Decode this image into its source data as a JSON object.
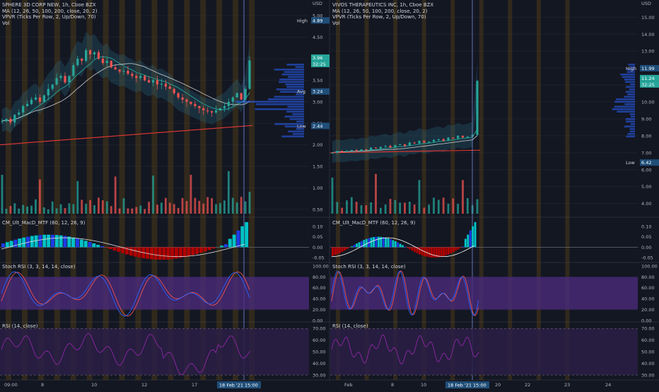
{
  "colors": {
    "bg": "#131722",
    "grid": "#1e222d",
    "up": "#26a69a",
    "down": "#ef5350",
    "macd_hist_up": "#00c2c7",
    "macd_hist_up2": "#1e3ae8",
    "macd_hist_down": "#b20000",
    "stoch_band": "#4a2a7a",
    "rsi_band": "#2a1f45",
    "stoch_k": "#2962ff",
    "stoch_d": "#ef5350",
    "rsi_line": "#9c27b0",
    "ma_red": "#e53935",
    "ma_white": "#e0e0e0",
    "ma_teal": "#26a69a",
    "session_highlight": "#6b4a12",
    "cursor_line": "#7b8bd6",
    "label_blue": "#1f4e79"
  },
  "panes": [
    {
      "id": "left",
      "title": "SPHERE 3D CORP NEW, 1h, Cboe BZX",
      "indicators": [
        "MA (12, 26, 50, 100, 200, close, 20, 2)",
        "VPVR (Ticks Per Row, 2, Up/Down, 70)",
        "Vol"
      ],
      "currency": "USD",
      "price_axis": [
        "5.00",
        "4.50",
        "4.00",
        "3.50",
        "3.00",
        "2.50",
        "2.00",
        "1.50",
        "1.00",
        "0.50"
      ],
      "price_range": [
        0.4,
        5.2
      ],
      "labels": {
        "high_label": "High",
        "high_value": "4.89",
        "last_value": "3.96",
        "countdown": "32:25",
        "avg_label": "Avg",
        "avg_value": "3.24",
        "low_label": "Low",
        "low_value": "2.44"
      },
      "x_axis": [
        "09:00",
        "8",
        "10",
        "12",
        "17"
      ],
      "cursor_date": "18 Feb '21",
      "cursor_time": "15:00",
      "macd": {
        "title": "CM_Ult_MacD_MTF (60, 12, 26, 9)",
        "axis": [
          "0.10",
          "0.05",
          "0.00",
          "-0.05"
        ]
      },
      "stoch": {
        "title": "Stoch RSI (3, 3, 14, 14, close)",
        "axis": [
          "100.00",
          "80.00",
          "60.00",
          "40.00",
          "20.00",
          "0.00"
        ]
      },
      "rsi": {
        "title": "RSI (14, close)",
        "axis": [
          "70.00",
          "60.00",
          "50.00",
          "40.00",
          "30.00"
        ]
      }
    },
    {
      "id": "right",
      "title": "VIVOS THERAPEUTICS INC, 1h, Cboe BZX",
      "indicators": [
        "MA (12, 26, 50, 100, 200, close, 20, 2)",
        "VPVR (Ticks Per Row, 2, Up/Down, 70)",
        "Vol"
      ],
      "currency": "USD",
      "price_axis": [
        "15.00",
        "14.00",
        "13.00",
        "12.00",
        "11.00",
        "10.00",
        "9.00",
        "8.00",
        "7.00",
        "6.00",
        "5.00",
        "4.00"
      ],
      "price_range": [
        3.4,
        15.6
      ],
      "labels": {
        "high_label": "High",
        "high_value": "11.99",
        "last_value": "11.24",
        "countdown": "32:25",
        "low_label": "Low",
        "low_value": "6.42"
      },
      "x_axis": [
        "Feb",
        "8",
        "10",
        "20",
        "22",
        "23",
        "24"
      ],
      "cursor_date": "18 Feb '21",
      "cursor_time": "15:00",
      "macd": {
        "title": "CM_Ult_MacD_MTF (60, 12, 26, 9)",
        "axis": [
          "0.10",
          "0.05",
          "0.00",
          "-0.05"
        ]
      },
      "stoch": {
        "title": "Stoch RSI (3, 3, 14, 14, close)",
        "axis": [
          "100.00",
          "80.00",
          "60.00",
          "40.00",
          "20.00",
          "0.00"
        ]
      },
      "rsi": {
        "title": "RSI (14, close)",
        "axis": [
          "70.00",
          "60.00",
          "50.00",
          "40.00",
          "30.00"
        ]
      }
    }
  ],
  "chart_data": [
    {
      "type": "line",
      "title": "SPHERE 3D CORP NEW, 1h, Cboe BZX",
      "ylabel": "USD",
      "ylim": [
        0.4,
        5.2
      ],
      "series": [
        {
          "name": "close",
          "values": [
            2.55,
            2.6,
            2.52,
            2.7,
            2.75,
            2.9,
            2.95,
            3.05,
            3.1,
            3.0,
            3.15,
            3.3,
            3.4,
            3.55,
            3.6,
            3.45,
            3.6,
            3.85,
            4.0,
            3.95,
            4.2,
            4.1,
            4.15,
            4.0,
            3.9,
            3.95,
            3.8,
            3.75,
            3.7,
            3.72,
            3.65,
            3.6,
            3.55,
            3.6,
            3.5,
            3.45,
            3.5,
            3.4,
            3.42,
            3.35,
            3.3,
            3.2,
            3.1,
            3.05,
            3.0,
            2.95,
            2.9,
            2.85,
            2.8,
            2.78,
            2.75,
            2.8,
            2.85,
            2.9,
            3.0,
            3.1,
            3.2,
            3.05,
            3.3,
            3.96
          ]
        },
        {
          "name": "MA 200",
          "values": [
            2.0,
            2.4
          ]
        }
      ]
    },
    {
      "type": "line",
      "title": "VIVOS THERAPEUTICS INC, 1h, Cboe BZX",
      "ylabel": "USD",
      "ylim": [
        3.4,
        15.6
      ],
      "series": [
        {
          "name": "close",
          "values": [
            7.0,
            7.1,
            7.05,
            7.1,
            7.15,
            7.1,
            7.2,
            7.15,
            7.3,
            7.25,
            7.35,
            7.4,
            7.3,
            7.45,
            7.5,
            7.4,
            7.6,
            7.55,
            7.7,
            7.6,
            7.65,
            7.75,
            7.8,
            7.7,
            7.9,
            7.85,
            8.0,
            7.9,
            7.95,
            8.05,
            11.24
          ]
        }
      ]
    }
  ]
}
